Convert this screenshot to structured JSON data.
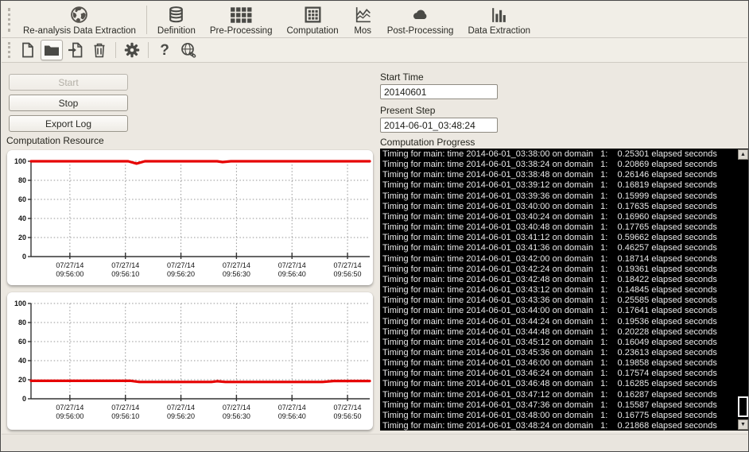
{
  "ribbon": {
    "items": [
      {
        "label": "Re-analysis Data Extraction",
        "icon": "globe-icon"
      },
      {
        "label": "Definition",
        "icon": "database-icon"
      },
      {
        "label": "Pre-Processing",
        "icon": "grid-icon"
      },
      {
        "label": "Computation",
        "icon": "spreadsheet-icon"
      },
      {
        "label": "Mos",
        "icon": "line-chart-icon"
      },
      {
        "label": "Post-Processing",
        "icon": "cloud-icon"
      },
      {
        "label": "Data Extraction",
        "icon": "bar-chart-icon"
      }
    ]
  },
  "toolbar": {
    "buttons": [
      {
        "name": "new-file-icon"
      },
      {
        "name": "open-folder-icon",
        "active": true
      },
      {
        "name": "import-icon"
      },
      {
        "name": "delete-icon"
      },
      {
        "name": "settings-gear-icon"
      },
      {
        "name": "help-icon",
        "glyph": "?"
      },
      {
        "name": "web-link-icon"
      }
    ]
  },
  "controls": {
    "start_label": "Start",
    "stop_label": "Stop",
    "export_log_label": "Export Log"
  },
  "left_panel": {
    "section_title": "Computation Resource"
  },
  "right_panel": {
    "start_time_label": "Start Time",
    "start_time_value": "20140601",
    "present_step_label": "Present Step",
    "present_step_value": "2014-06-01_03:48:24",
    "progress_label": "Computation Progress"
  },
  "terminal": {
    "lines": [
      "Timing for main: time 2014-06-01_03:38:00 on domain   1:    0.25301 elapsed seconds",
      "Timing for main: time 2014-06-01_03:38:24 on domain   1:    0.20869 elapsed seconds",
      "Timing for main: time 2014-06-01_03:38:48 on domain   1:    0.26146 elapsed seconds",
      "Timing for main: time 2014-06-01_03:39:12 on domain   1:    0.16819 elapsed seconds",
      "Timing for main: time 2014-06-01_03:39:36 on domain   1:    0.15999 elapsed seconds",
      "Timing for main: time 2014-06-01_03:40:00 on domain   1:    0.17635 elapsed seconds",
      "Timing for main: time 2014-06-01_03:40:24 on domain   1:    0.16960 elapsed seconds",
      "Timing for main: time 2014-06-01_03:40:48 on domain   1:    0.17765 elapsed seconds",
      "Timing for main: time 2014-06-01_03:41:12 on domain   1:    0.59662 elapsed seconds",
      "Timing for main: time 2014-06-01_03:41:36 on domain   1:    0.46257 elapsed seconds",
      "Timing for main: time 2014-06-01_03:42:00 on domain   1:    0.18714 elapsed seconds",
      "Timing for main: time 2014-06-01_03:42:24 on domain   1:    0.19361 elapsed seconds",
      "Timing for main: time 2014-06-01_03:42:48 on domain   1:    0.18422 elapsed seconds",
      "Timing for main: time 2014-06-01_03:43:12 on domain   1:    0.14845 elapsed seconds",
      "Timing for main: time 2014-06-01_03:43:36 on domain   1:    0.25585 elapsed seconds",
      "Timing for main: time 2014-06-01_03:44:00 on domain   1:    0.17641 elapsed seconds",
      "Timing for main: time 2014-06-01_03:44:24 on domain   1:    0.19536 elapsed seconds",
      "Timing for main: time 2014-06-01_03:44:48 on domain   1:    0.20228 elapsed seconds",
      "Timing for main: time 2014-06-01_03:45:12 on domain   1:    0.16049 elapsed seconds",
      "Timing for main: time 2014-06-01_03:45:36 on domain   1:    0.23613 elapsed seconds",
      "Timing for main: time 2014-06-01_03:46:00 on domain   1:    0.19858 elapsed seconds",
      "Timing for main: time 2014-06-01_03:46:24 on domain   1:    0.17574 elapsed seconds",
      "Timing for main: time 2014-06-01_03:46:48 on domain   1:    0.16285 elapsed seconds",
      "Timing for main: time 2014-06-01_03:47:12 on domain   1:    0.16287 elapsed seconds",
      "Timing for main: time 2014-06-01_03:47:36 on domain   1:    0.15587 elapsed seconds",
      "Timing for main: time 2014-06-01_03:48:00 on domain   1:    0.16775 elapsed seconds",
      "Timing for main: time 2014-06-01_03:48:24 on domain   1:    0.21868 elapsed seconds"
    ]
  },
  "chart_data": [
    {
      "type": "line",
      "title": "",
      "xlabel": "",
      "ylabel": "",
      "ylim": [
        0,
        100
      ],
      "y_ticks": [
        0,
        20,
        40,
        60,
        80,
        100
      ],
      "x_domain_seconds": [
        -7,
        54
      ],
      "x_ticks": [
        {
          "s": 0,
          "date": "07/27/14",
          "time": "09:56:00"
        },
        {
          "s": 10,
          "date": "07/27/14",
          "time": "09:56:10"
        },
        {
          "s": 20,
          "date": "07/27/14",
          "time": "09:56:20"
        },
        {
          "s": 30,
          "date": "07/27/14",
          "time": "09:56:30"
        },
        {
          "s": 40,
          "date": "07/27/14",
          "time": "09:56:40"
        },
        {
          "s": 50,
          "date": "07/27/14",
          "time": "09:56:50"
        }
      ],
      "grid": true,
      "series": [
        {
          "name": "resource-usage-top",
          "color": "#e60000",
          "points": [
            [
              -7,
              100
            ],
            [
              10.5,
              100
            ],
            [
              12,
              97.6
            ],
            [
              13.5,
              100
            ],
            [
              26.5,
              100
            ],
            [
              27.5,
              99.2
            ],
            [
              29,
              100
            ],
            [
              54,
              100
            ]
          ]
        }
      ]
    },
    {
      "type": "line",
      "title": "",
      "xlabel": "",
      "ylabel": "",
      "ylim": [
        0,
        100
      ],
      "y_ticks": [
        0,
        20,
        40,
        60,
        80,
        100
      ],
      "x_domain_seconds": [
        -7,
        54
      ],
      "x_ticks": [
        {
          "s": 0,
          "date": "07/27/14",
          "time": "09:56:00"
        },
        {
          "s": 10,
          "date": "07/27/14",
          "time": "09:56:10"
        },
        {
          "s": 20,
          "date": "07/27/14",
          "time": "09:56:20"
        },
        {
          "s": 30,
          "date": "07/27/14",
          "time": "09:56:30"
        },
        {
          "s": 40,
          "date": "07/27/14",
          "time": "09:56:40"
        },
        {
          "s": 50,
          "date": "07/27/14",
          "time": "09:56:50"
        }
      ],
      "grid": true,
      "series": [
        {
          "name": "resource-usage-bottom",
          "color": "#e60000",
          "points": [
            [
              -7,
              18.8
            ],
            [
              11,
              18.8
            ],
            [
              12.5,
              17.7
            ],
            [
              25.5,
              17.7
            ],
            [
              26.5,
              18.4
            ],
            [
              28,
              17.7
            ],
            [
              45.5,
              17.7
            ],
            [
              47.5,
              18.7
            ],
            [
              54,
              18.7
            ]
          ]
        }
      ]
    }
  ]
}
